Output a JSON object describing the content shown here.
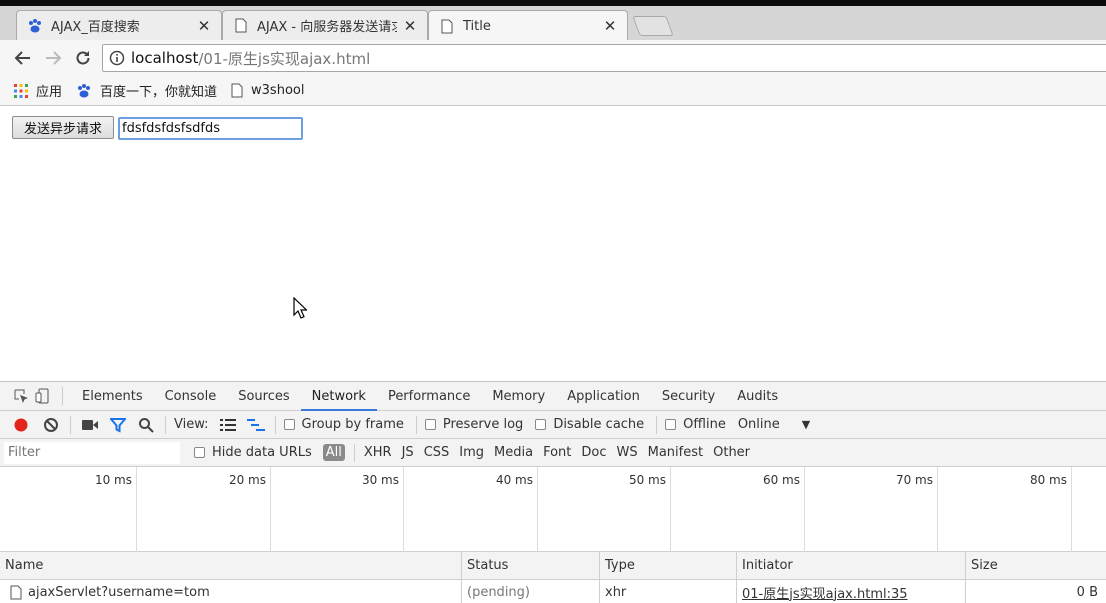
{
  "browser": {
    "tabs": [
      {
        "title": "AJAX_百度搜索",
        "favicon": "baidu-paw-icon",
        "active": false
      },
      {
        "title": "AJAX - 向服务器发送请求",
        "favicon": "page-icon",
        "active": false
      },
      {
        "title": "Title",
        "favicon": "page-icon",
        "active": true
      }
    ],
    "address": {
      "host": "localhost",
      "path": "/01-原生js实现ajax.html"
    },
    "bookmarks": [
      {
        "label": "应用",
        "icon": "apps-grid-icon"
      },
      {
        "label": "百度一下，你就知道",
        "icon": "baidu-paw-icon"
      },
      {
        "label": "w3shool",
        "icon": "page-icon"
      }
    ]
  },
  "page": {
    "send_button_label": "发送异步请求",
    "input_value": "fdsfdsfdsfsdfds"
  },
  "devtools": {
    "tabs": [
      "Elements",
      "Console",
      "Sources",
      "Network",
      "Performance",
      "Memory",
      "Application",
      "Security",
      "Audits"
    ],
    "active_tab": "Network",
    "toolbar": {
      "view_label": "View:",
      "group_by_frame": "Group by frame",
      "preserve_log": "Preserve log",
      "disable_cache": "Disable cache",
      "offline": "Offline",
      "throttle": "Online"
    },
    "filter": {
      "placeholder": "Filter",
      "hide_data_urls": "Hide data URLs",
      "types": [
        "All",
        "XHR",
        "JS",
        "CSS",
        "Img",
        "Media",
        "Font",
        "Doc",
        "WS",
        "Manifest",
        "Other"
      ]
    },
    "timeline_ticks": [
      "10 ms",
      "20 ms",
      "30 ms",
      "40 ms",
      "50 ms",
      "60 ms",
      "70 ms",
      "80 ms"
    ],
    "columns": [
      "Name",
      "Status",
      "Type",
      "Initiator",
      "Size"
    ],
    "rows": [
      {
        "name": "ajaxServlet?username=tom",
        "status": "(pending)",
        "type": "xhr",
        "initiator": "01-原生js实现ajax.html:35",
        "size": "0 B"
      }
    ]
  },
  "colors": {
    "record": "#e3241b",
    "accent": "#3879d9",
    "filter_icon": "#1a73e8"
  }
}
